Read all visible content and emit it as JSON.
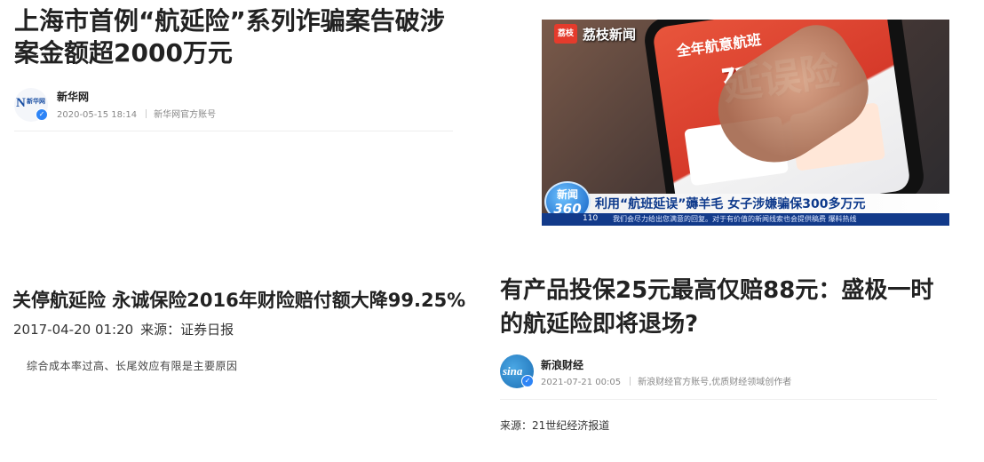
{
  "article1": {
    "title": "上海市首例“航延险”系列诈骗案告破涉案金额超2000万元",
    "source_name": "新华网",
    "datetime": "2020-05-15 18:14",
    "account_desc": "新华网官方账号",
    "avatar_text": "新华网"
  },
  "video": {
    "brand": "荔枝新闻",
    "brand_mark": "荔枝",
    "screen_heading": "全年航意航班",
    "screen_big": "延误险",
    "badge_line1": "新闻",
    "badge_line2": "360",
    "caption": "利用“航班延误”薅羊毛  女子涉嫌骗保300多万元",
    "ticker_num": "110",
    "ticker_text": "我们会尽力给出您满意的回复。对于有价值的新闻线索也会提供稿费  爆料热线"
  },
  "article2": {
    "title": "关停航延险 永诚保险2016年财险赔付额大降99.25%",
    "date": "2017-04-20 01:20",
    "source": "来源：证券日报",
    "subtitle": "综合成本率过高、长尾效应有限是主要原因"
  },
  "article3": {
    "title": "有产品投保25元最高仅赔88元：盛极一时的航延险即将退场?",
    "source_name": "新浪财经",
    "datetime": "2021-07-21 00:05",
    "account_desc": "新浪财经官方账号,优质财经领域创作者",
    "avatar_text": "sina",
    "source_line": "来源：21世纪经济报道"
  }
}
